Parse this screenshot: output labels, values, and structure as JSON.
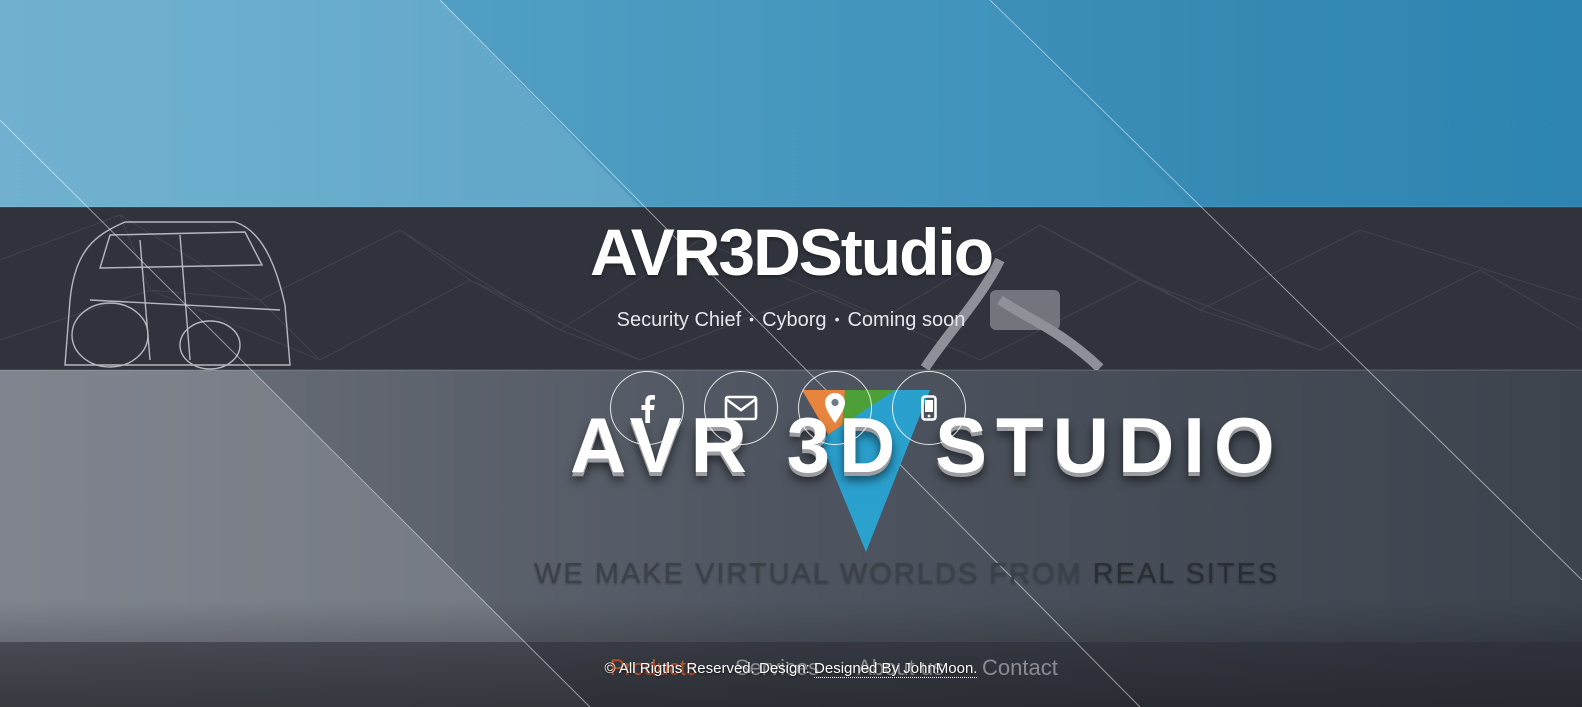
{
  "header": {
    "title": "AVR3DStudio",
    "subtitle_items": [
      "Security Chief",
      "Cyborg",
      "Coming soon"
    ],
    "separator": "•"
  },
  "social": [
    {
      "icon": "facebook-icon",
      "name": "facebook-button"
    },
    {
      "icon": "envelope-icon",
      "name": "email-button"
    },
    {
      "icon": "map-marker-icon",
      "name": "location-button"
    },
    {
      "icon": "mobile-phone-icon",
      "name": "phone-button"
    }
  ],
  "banner": {
    "brand_text": "AVR 3D STUDIO",
    "tagline_part1": "WE MAKE VIRTUAL WORLDS FROM ",
    "tagline_part2": "REAL SITES"
  },
  "nav": {
    "items": [
      "Products",
      "Services",
      "About us",
      "Contact"
    ]
  },
  "footer": {
    "text": "© All Rigths Reserved. Design: ",
    "link_text": "Designed By JohnMoon."
  },
  "colors": {
    "sky_blue": "#3a8fbb",
    "dark_band": "#2f323b",
    "slate": "#555b66",
    "logo_orange": "#f0883d",
    "logo_green": "#4ca535",
    "logo_blue": "#29a5d4"
  }
}
